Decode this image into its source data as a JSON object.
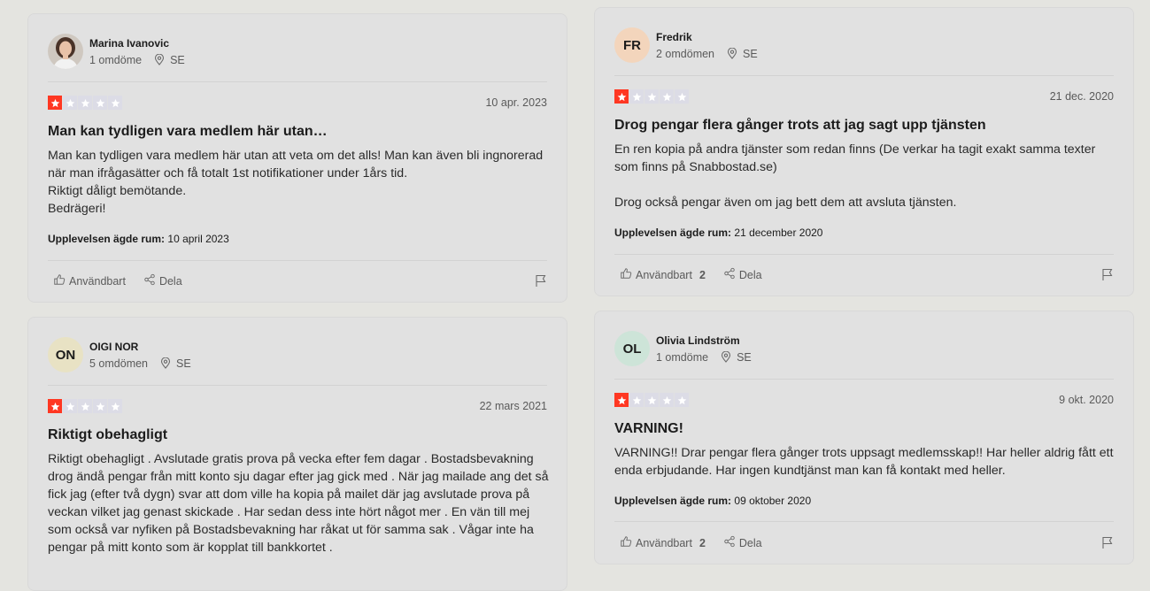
{
  "colors": {
    "star_active": "#ff3722",
    "star_inactive": "#dcdce6"
  },
  "labels": {
    "useful": "Användbart",
    "share": "Dela",
    "experience_prefix": "Upplevelsen ägde rum:"
  },
  "reviews": [
    {
      "author": "Marina Ivanovic",
      "avatar_type": "photo",
      "reviews_count": "1 omdöme",
      "country": "SE",
      "rating": 1,
      "date": "10 apr. 2023",
      "title": "Man kan tydligen vara medlem här utan…",
      "body": "Man kan tydligen vara medlem här utan att veta om det alls! Man kan även bli ingnorerad när man ifrågasätter och få totalt 1st notifikationer under 1års tid.\nRiktigt dåligt bemötande.\nBedrägeri!",
      "experience_date": "10 april 2023",
      "useful_count": ""
    },
    {
      "author": "OIGI NOR",
      "initials": "ON",
      "avatar_color": "#e8e2c4",
      "reviews_count": "5 omdömen",
      "country": "SE",
      "rating": 1,
      "date": "22 mars 2021",
      "title": "Riktigt obehagligt",
      "body": "Riktigt obehagligt . Avslutade gratis prova på vecka efter fem dagar . Bostadsbevakning drog ändå pengar från mitt konto sju dagar efter jag gick med . När jag mailade ang det så fick jag (efter två dygn) svar att dom ville ha kopia på mailet där jag avslutade prova på veckan vilket jag genast skickade . Har sedan dess inte hört något mer . En vän till mej som också var nyfiken på Bostadsbevakning har råkat ut för samma sak . Vågar inte ha pengar på mitt konto som är kopplat till bankkortet ."
    },
    {
      "author": "Fredrik",
      "initials": "FR",
      "avatar_color": "#f3d5bc",
      "reviews_count": "2 omdömen",
      "country": "SE",
      "rating": 1,
      "date": "21 dec. 2020",
      "title": "Drog pengar flera gånger trots att jag sagt upp tjänsten",
      "body": "En ren kopia på andra tjänster som redan finns (De verkar ha tagit exakt samma texter som finns på Snabbostad.se)\n\nDrog också pengar även om jag bett dem att avsluta tjänsten.",
      "experience_date": "21 december 2020",
      "useful_count": "2"
    },
    {
      "author": "Olivia Lindström",
      "initials": "OL",
      "avatar_color": "#cde4d8",
      "reviews_count": "1 omdöme",
      "country": "SE",
      "rating": 1,
      "date": "9 okt. 2020",
      "title": "VARNING!",
      "body": "VARNING!! Drar pengar flera gånger trots uppsagt medlemsskap!! Har heller aldrig fått ett enda erbjudande. Har ingen kundtjänst man kan få kontakt med heller.",
      "experience_date": "09 oktober 2020",
      "useful_count": "2"
    }
  ]
}
